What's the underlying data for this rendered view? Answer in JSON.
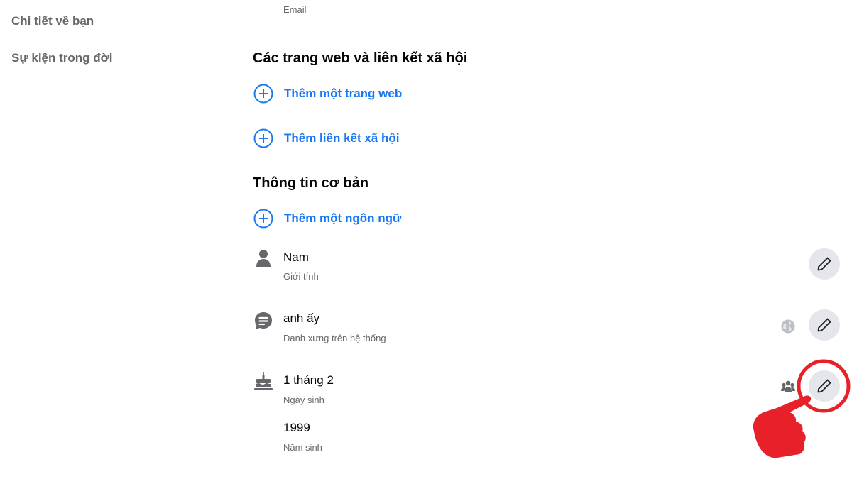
{
  "sidebar": {
    "items": [
      {
        "label": "Chi tiết về bạn"
      },
      {
        "label": "Sự kiện trong đời"
      }
    ]
  },
  "contact": {
    "email_caption": "Email"
  },
  "websites": {
    "title": "Các trang web và liên kết xã hội",
    "add_website": "Thêm một trang web",
    "add_social": "Thêm liên kết xã hội"
  },
  "basic_info": {
    "title": "Thông tin cơ bản",
    "add_language": "Thêm một ngôn ngữ",
    "gender": {
      "value": "Nam",
      "label": "Giới tính",
      "icon": "person-icon"
    },
    "pronoun": {
      "value": "anh ấy",
      "label": "Danh xưng trên hệ thống",
      "icon": "chat-icon",
      "audience": "globe-icon"
    },
    "birthday": {
      "value": "1 tháng 2",
      "label": "Ngày sinh",
      "icon": "cake-icon",
      "audience": "friends-icon"
    },
    "birth_year": {
      "value": "1999",
      "label": "Năm sinh",
      "audience": "friends-icon"
    }
  },
  "colors": {
    "accent": "#1877f2",
    "annotation_red": "#e8202a",
    "icon_gray": "#65676b",
    "button_gray": "#e4e6eb"
  }
}
